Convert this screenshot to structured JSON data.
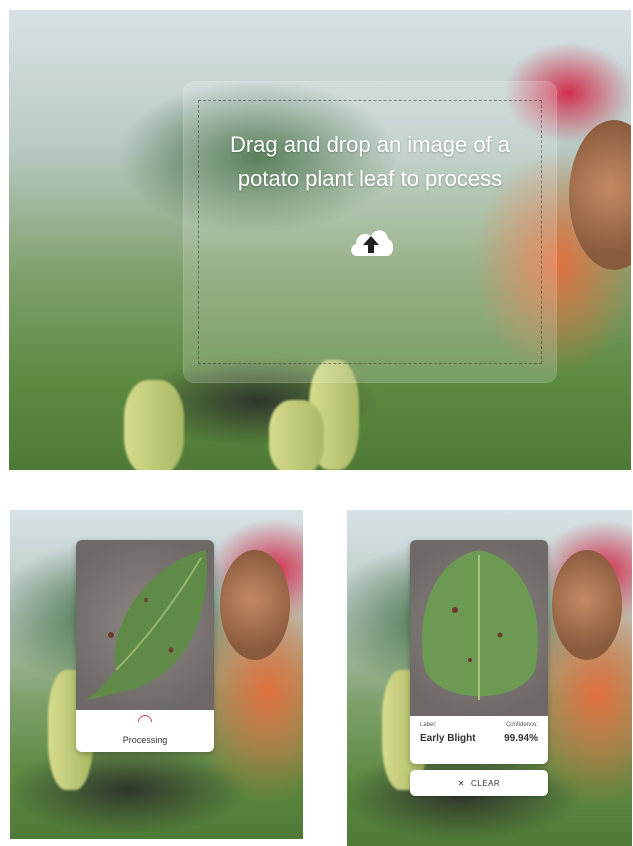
{
  "hero": {
    "message": "Drag and drop an image of a potato plant leaf to process",
    "icon": "cloud-upload-icon"
  },
  "processing": {
    "status_text": "Processing",
    "icon": "spinner-icon"
  },
  "result": {
    "label_caption": "Label:",
    "label_value": "Early Blight",
    "confidence_caption": "Confidence:",
    "confidence_value": "99.94%",
    "clear_label": "CLEAR",
    "clear_icon": "close-icon"
  },
  "colors": {
    "leaf": "#5f8a48",
    "spinner": "#c04a6a",
    "upload_icon_bg": "#ffffff",
    "upload_arrow": "#222222"
  }
}
